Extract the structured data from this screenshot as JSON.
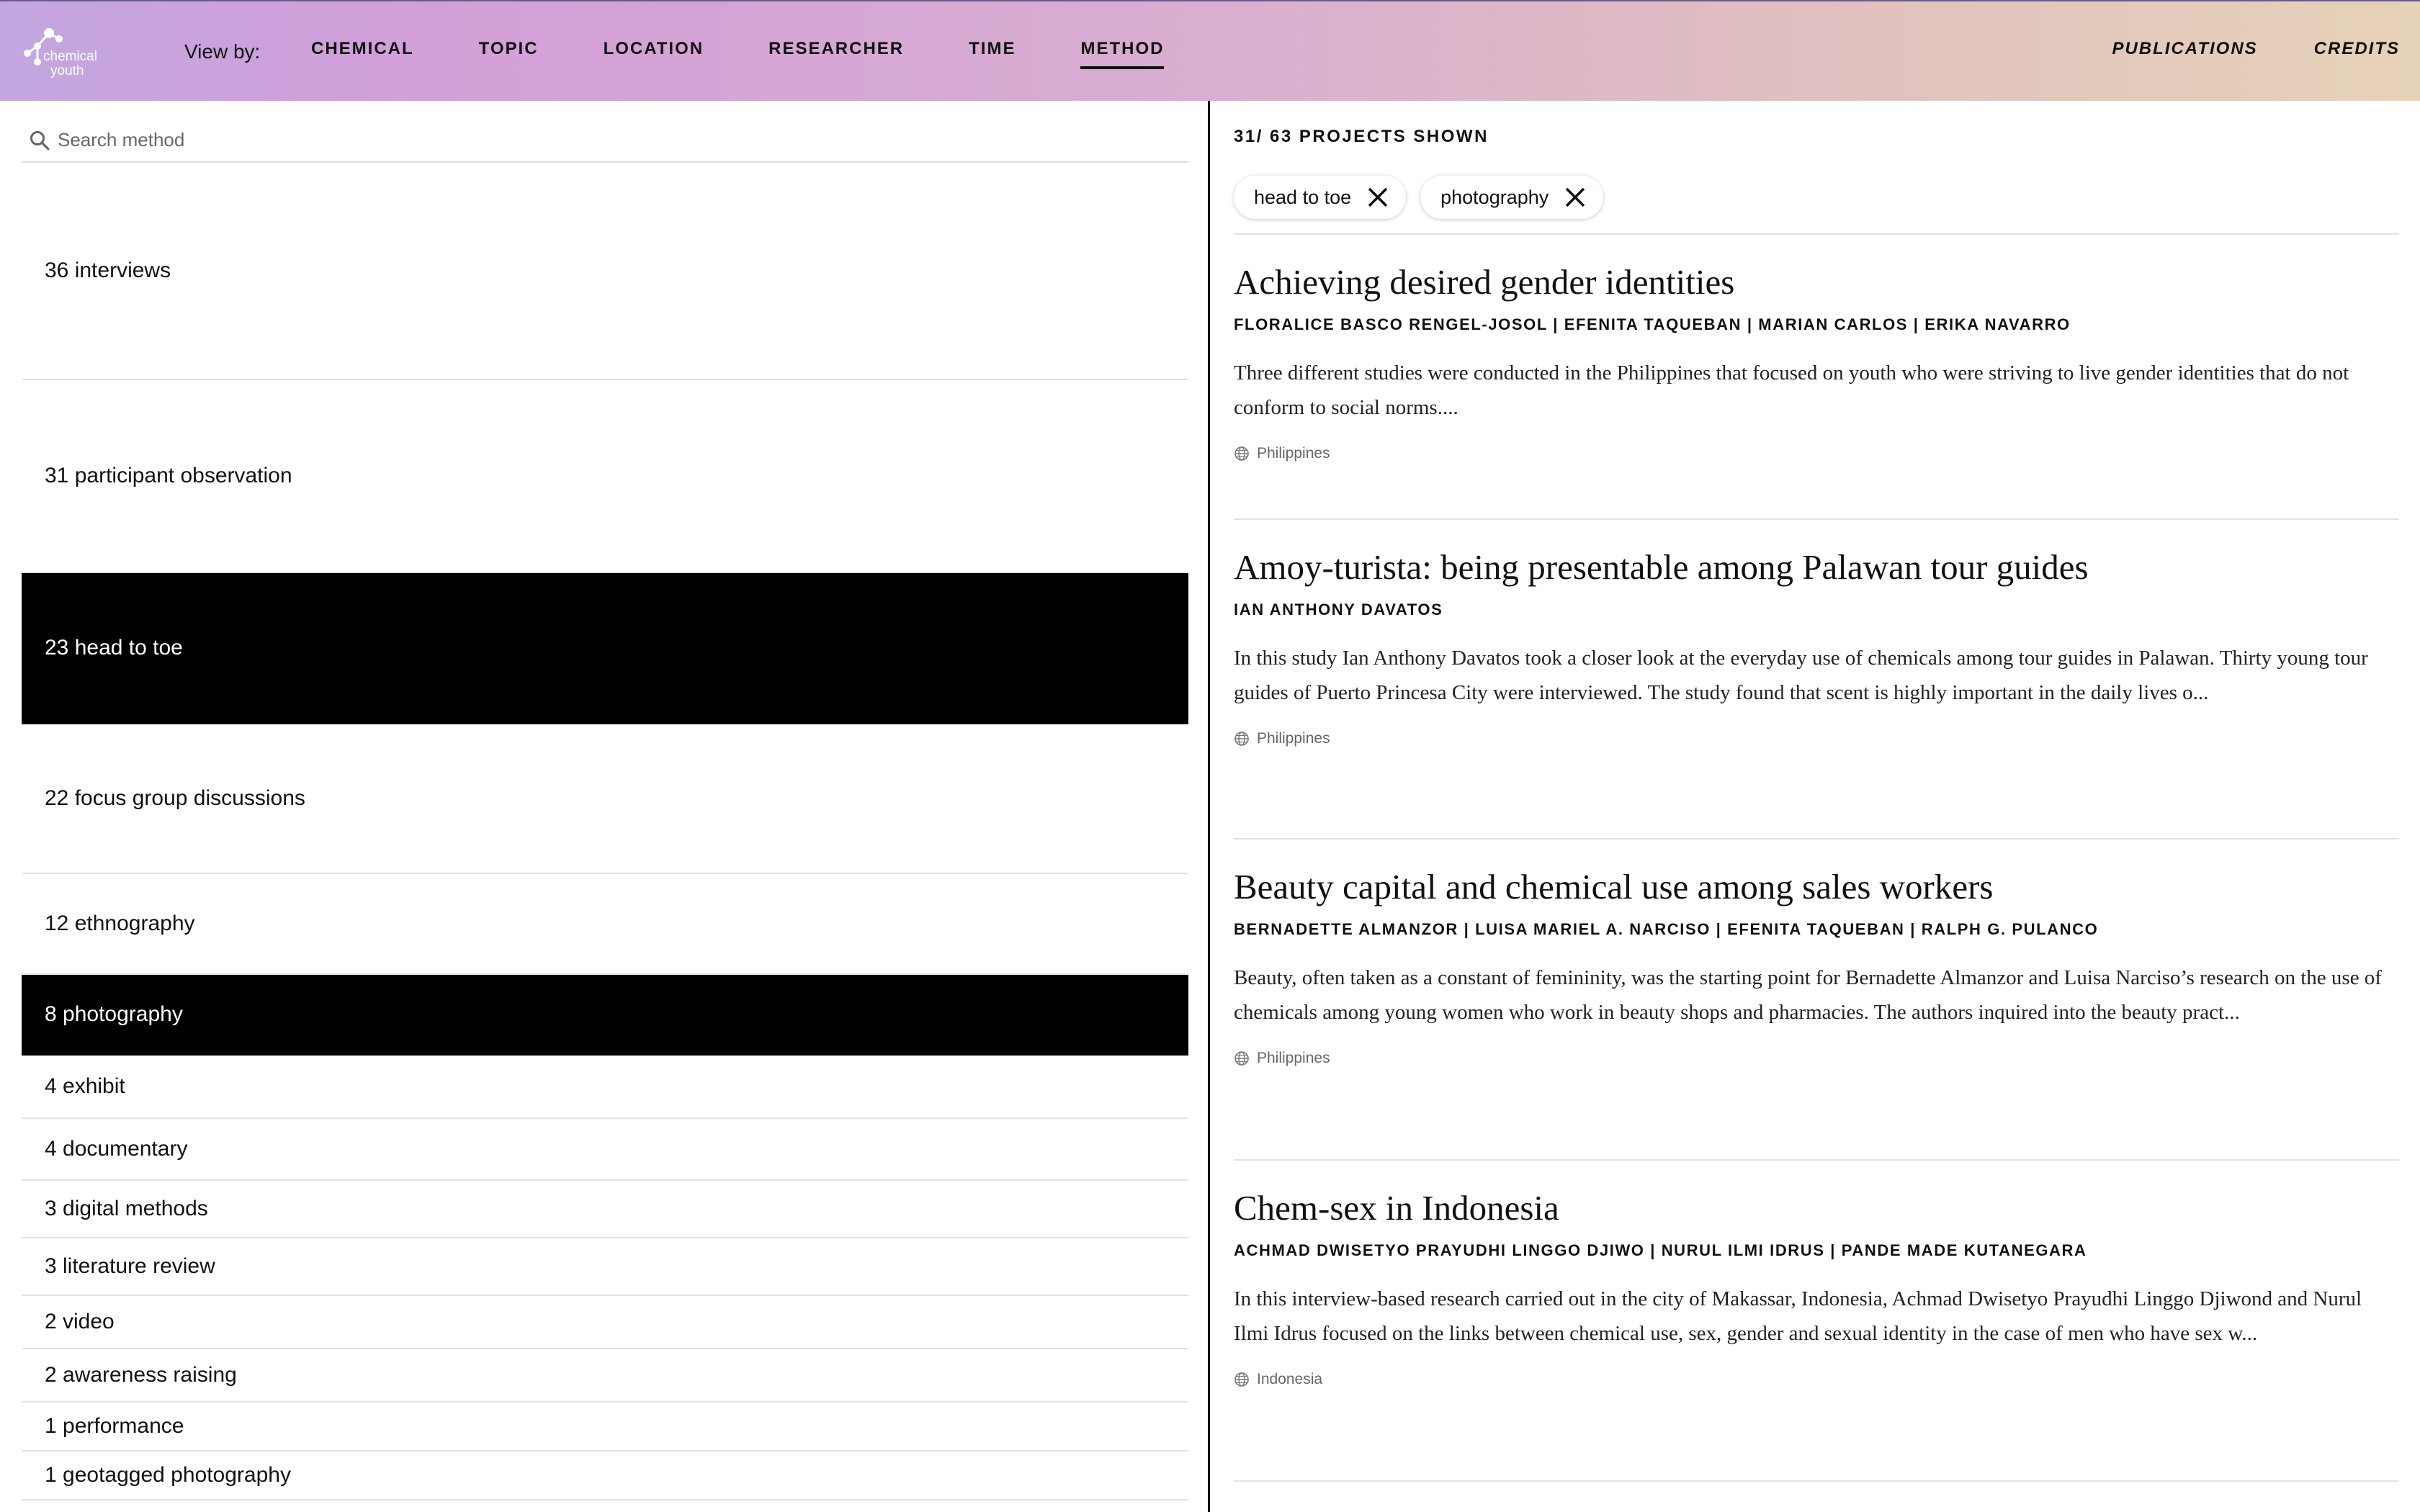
{
  "header": {
    "logo_text": "chemical youth",
    "view_by_label": "View by:",
    "nav": [
      {
        "label": "CHEMICAL"
      },
      {
        "label": "TOPIC"
      },
      {
        "label": "LOCATION"
      },
      {
        "label": "RESEARCHER"
      },
      {
        "label": "TIME"
      },
      {
        "label": "METHOD",
        "active": true
      }
    ],
    "right_links": [
      {
        "label": "PUBLICATIONS"
      },
      {
        "label": "CREDITS"
      }
    ]
  },
  "search": {
    "placeholder": "Search method",
    "value": ""
  },
  "methods": [
    {
      "label": "36 interviews",
      "selected": false
    },
    {
      "label": "31 participant observation",
      "selected": false
    },
    {
      "label": "23 head to toe",
      "selected": true
    },
    {
      "label": "22 focus group discussions",
      "selected": false
    },
    {
      "label": "12 ethnography",
      "selected": false
    },
    {
      "label": "8 photography",
      "selected": true
    },
    {
      "label": "4 exhibit",
      "selected": false
    },
    {
      "label": "4 documentary",
      "selected": false
    },
    {
      "label": "3 digital methods",
      "selected": false
    },
    {
      "label": "3 literature review",
      "selected": false
    },
    {
      "label": "2 video",
      "selected": false
    },
    {
      "label": "2 awareness raising",
      "selected": false
    },
    {
      "label": "1 performance",
      "selected": false
    },
    {
      "label": "1 geotagged photography",
      "selected": false
    }
  ],
  "results": {
    "count_label": "31/ 63 PROJECTS SHOWN",
    "filters": [
      {
        "label": "head to toe",
        "icon": "close-icon"
      },
      {
        "label": "photography",
        "icon": "close-icon"
      }
    ],
    "projects": [
      {
        "title": "Achieving desired gender identities",
        "authors": "FLORALICE BASCO RENGEL-JOSOL | EFENITA TAQUEBAN | MARIAN CARLOS | ERIKA NAVARRO",
        "description": "Three different studies were conducted in the Philippines that focused on youth who were striving to live gender identities that do not conform to social norms....",
        "location": "Philippines"
      },
      {
        "title": "Amoy-turista: being presentable among Palawan tour guides",
        "authors": "IAN ANTHONY DAVATOS",
        "description": "In this study Ian Anthony Davatos took a closer look at the everyday use of chemicals among tour guides in Palawan. Thirty young tour guides of Puerto Princesa City were interviewed. The study found that scent is highly important in the daily lives o...",
        "location": "Philippines"
      },
      {
        "title": "Beauty capital and chemical use among sales workers",
        "authors": "BERNADETTE ALMANZOR | LUISA MARIEL A. NARCISO | EFENITA TAQUEBAN | RALPH G. PULANCO",
        "description": "Beauty, often taken as a constant of femininity, was the starting point for Bernadette Almanzor and Luisa Narciso’s research on the use of chemicals among young women who work in beauty shops and pharmacies. The authors inquired into the beauty pract...",
        "location": "Philippines"
      },
      {
        "title": "Chem-sex in Indonesia",
        "authors": "ACHMAD DWISETYO PRAYUDHI LINGGO DJIWO | NURUL ILMI IDRUS | PANDE MADE KUTANEGARA",
        "description": "In this interview-based research carried out in the city of Makassar, Indonesia, Achmad Dwisetyo Prayudhi Linggo Djiwond and Nurul Ilmi Idrus focused on the links between chemical use, sex, gender and sexual identity in the case of men who have sex w...",
        "location": "Indonesia"
      }
    ]
  }
}
